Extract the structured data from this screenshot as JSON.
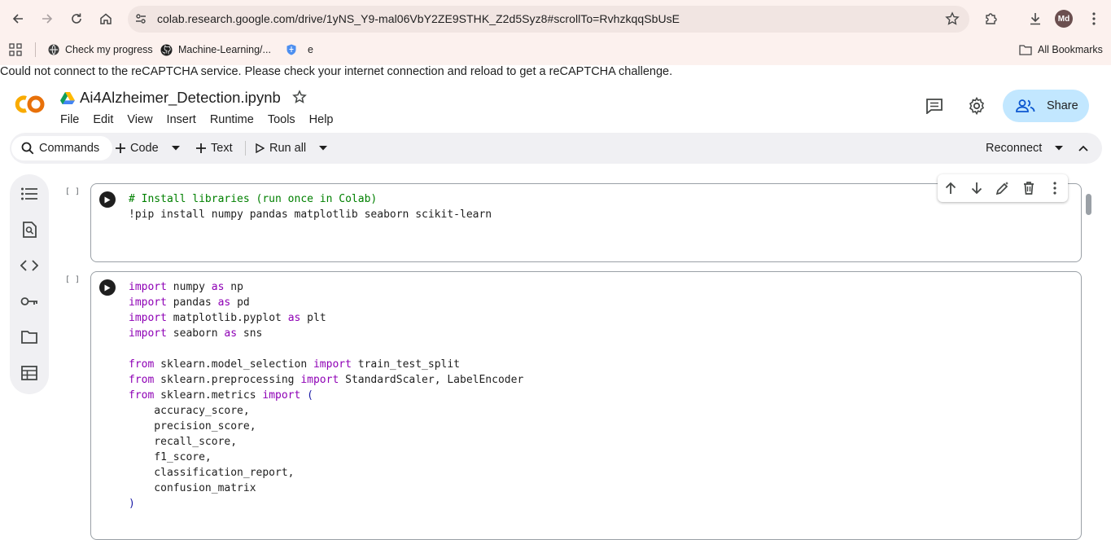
{
  "browser": {
    "url": "colab.research.google.com/drive/1yNS_Y9-mal06VbY2ZE9STHK_Z2d5Syz8#scrollTo=RvhzkqqSbUsE",
    "avatar_initials": "Md",
    "bookmarks": [
      {
        "label": "Check my progress",
        "icon": "globe-icon"
      },
      {
        "label": "Machine-Learning/...",
        "icon": "github-icon"
      },
      {
        "label": "e",
        "icon": "shield-icon"
      }
    ],
    "all_bookmarks_label": "All Bookmarks"
  },
  "warning_text": "Could not connect to the reCAPTCHA service. Please check your internet connection and reload to get a reCAPTCHA challenge.",
  "colab": {
    "notebook_title": "Ai4Alzheimer_Detection.ipynb",
    "menu": [
      "File",
      "Edit",
      "View",
      "Insert",
      "Runtime",
      "Tools",
      "Help"
    ],
    "share_label": "Share",
    "brand_color": "#f9ab00",
    "share_bg": "#c2e7ff"
  },
  "toolbar": {
    "commands_label": "Commands",
    "code_label": "Code",
    "text_label": "Text",
    "run_all_label": "Run all",
    "reconnect_label": "Reconnect"
  },
  "cells": [
    {
      "exec_count": "[ ]",
      "lines": [
        "# Install libraries (run once in Colab)",
        "!pip install numpy pandas matplotlib seaborn scikit-learn"
      ]
    },
    {
      "exec_count": "[ ]",
      "lines": [
        "import numpy as np",
        "import pandas as pd",
        "import matplotlib.pyplot as plt",
        "import seaborn as sns",
        "",
        "from sklearn.model_selection import train_test_split",
        "from sklearn.preprocessing import StandardScaler, LabelEncoder",
        "from sklearn.metrics import (",
        "    accuracy_score,",
        "    precision_score,",
        "    recall_score,",
        "    f1_score,",
        "    classification_report,",
        "    confusion_matrix",
        ")"
      ]
    }
  ]
}
